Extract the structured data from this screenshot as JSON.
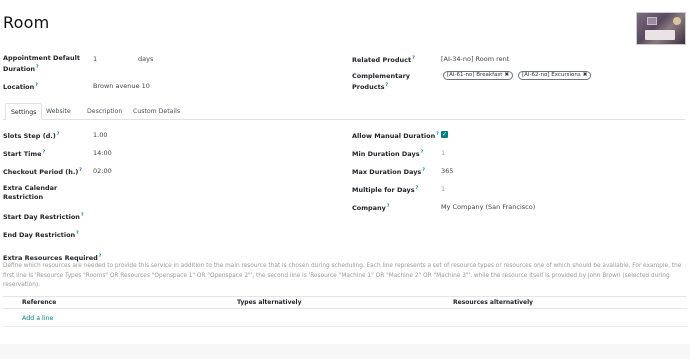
{
  "record": {
    "title": "Room"
  },
  "left_fields": {
    "appointment_duration_label": "Appointment Default Duration",
    "appointment_duration_value": "1",
    "appointment_duration_unit": "days",
    "location_label": "Location",
    "location_value": "Brown avenue 10"
  },
  "right_fields": {
    "related_product_label": "Related Product",
    "related_product_value": "[AI-34-no] Room rent",
    "complementary_label": "Complementary Products",
    "complementary_tags": [
      "[AI-61-no] Breakfast",
      "[AI-62-no] Excursions"
    ]
  },
  "tabs": [
    "Settings",
    "Website",
    "Description",
    "Custom Details"
  ],
  "settings_left": {
    "slots_step_label": "Slots Step (d.)",
    "slots_step_value": "1.00",
    "start_time_label": "Start Time",
    "start_time_value": "14:00",
    "checkout_label": "Checkout Period (h.)",
    "checkout_value": "02:00",
    "extra_calendar_label": "Extra Calendar Restriction",
    "start_day_label": "Start Day Restriction",
    "end_day_label": "End Day Restriction"
  },
  "settings_right": {
    "allow_manual_label": "Allow Manual Duration",
    "allow_manual_checked": true,
    "min_duration_label": "Min Duration Days",
    "min_duration_value": "1",
    "max_duration_label": "Max Duration Days",
    "max_duration_value": "365",
    "multiple_label": "Multiple for Days",
    "multiple_value": "1",
    "company_label": "Company",
    "company_value": "My Company (San Francisco)"
  },
  "extra_resources": {
    "label": "Extra Resources Required",
    "description": "Define which resources are needed to provide this service in addition to the main resource that is chosen during scheduling. Each line represents a set of resource types or resources one of which should be available. For example, the first line is 'Resource Types \"Rooms\" OR Resources \"Openspace 1\" OR \"Openspace 2\"', the second line is 'Resource \"Machine 1\" OR \"Machine 2\" OR \"Machine 3\"', while the resource itself is provided by John Brown (selected during reservation).",
    "columns": [
      "Reference",
      "Types alternatively",
      "Resources alternatively"
    ],
    "add_line": "Add a line"
  },
  "help_marker": "?"
}
